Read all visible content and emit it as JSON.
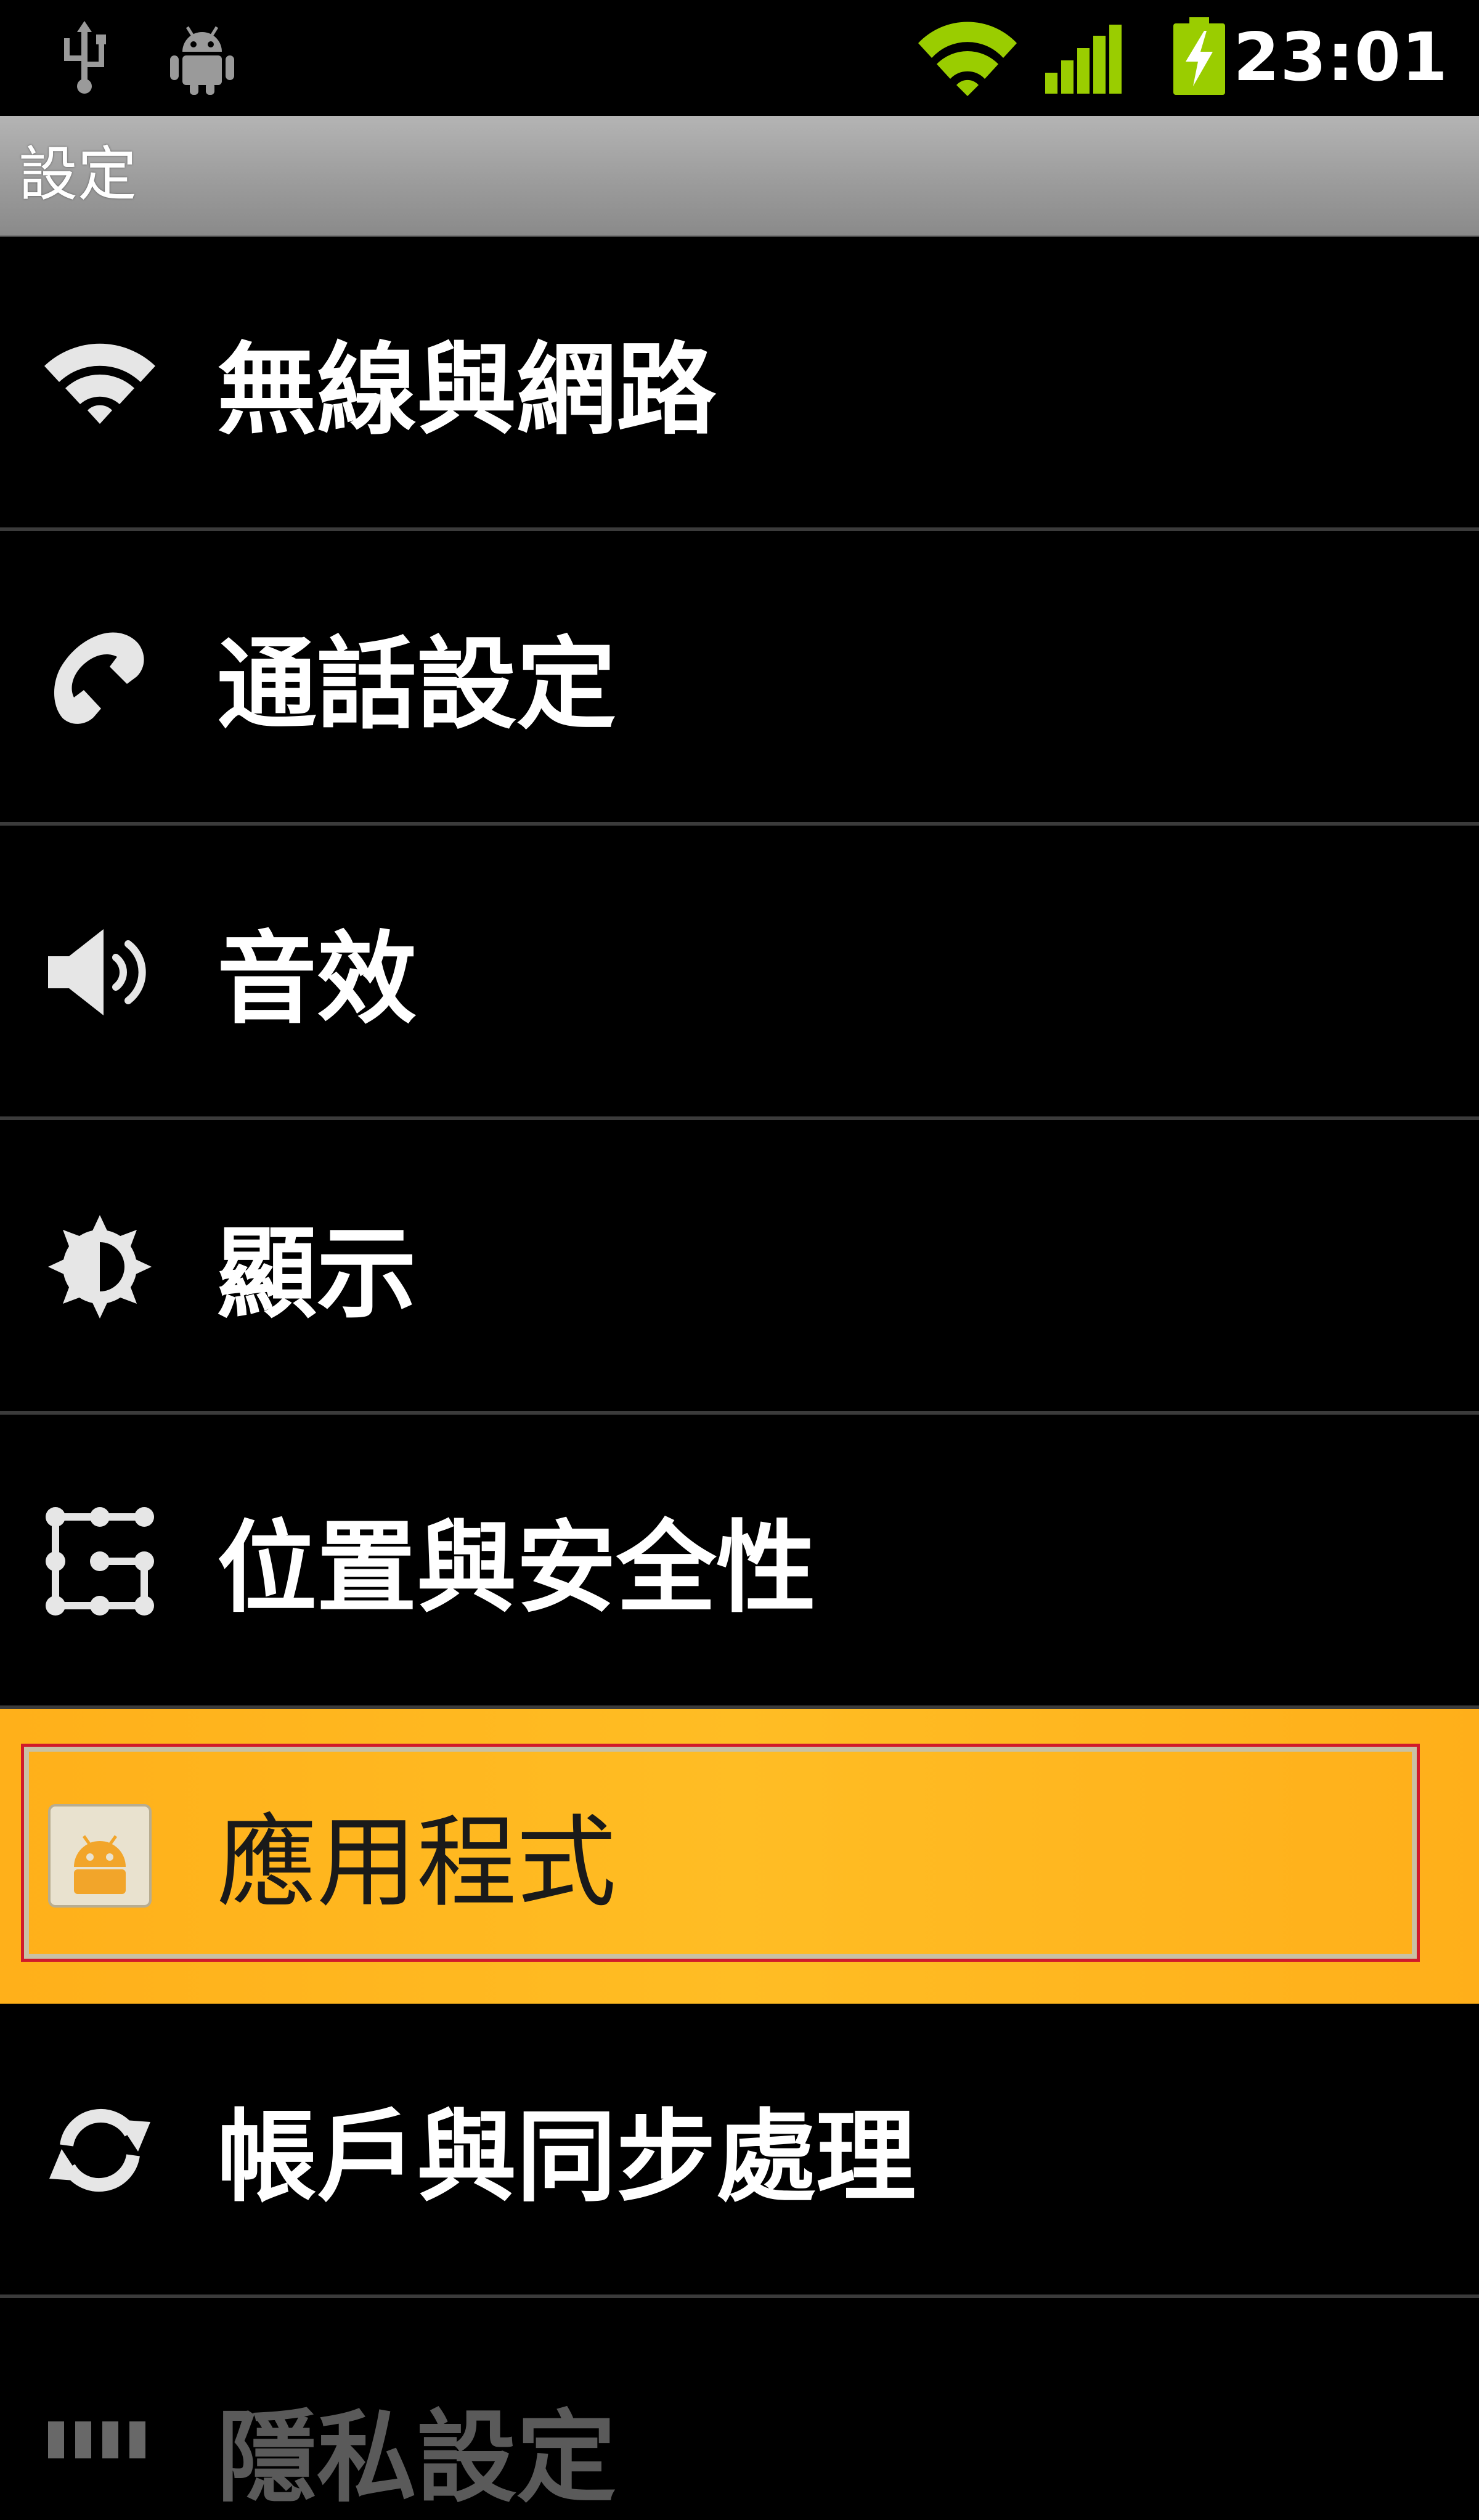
{
  "status_bar": {
    "time": "23:01",
    "icons": [
      "usb-icon",
      "android-debug-icon",
      "wifi-signal-icon",
      "cell-signal-icon",
      "battery-charging-icon"
    ]
  },
  "title_bar": {
    "title": "設定"
  },
  "settings_list": {
    "items": [
      {
        "label": "無線與網路",
        "icon": "wifi-icon"
      },
      {
        "label": "通話設定",
        "icon": "phone-icon"
      },
      {
        "label": "音效",
        "icon": "speaker-icon"
      },
      {
        "label": "顯示",
        "icon": "brightness-icon"
      },
      {
        "label": "位置與安全性",
        "icon": "location-security-icon"
      },
      {
        "label": "應用程式",
        "icon": "applications-icon",
        "selected": true
      },
      {
        "label": "帳戶與同步處理",
        "icon": "sync-icon"
      },
      {
        "label": "隱私設定",
        "icon": "privacy-icon"
      }
    ]
  },
  "colors": {
    "selected_highlight": "#FFB81F",
    "focus_ring": "#D11A2A",
    "wifi_green": "#9ACD00",
    "divider": "#3B3B3B"
  }
}
